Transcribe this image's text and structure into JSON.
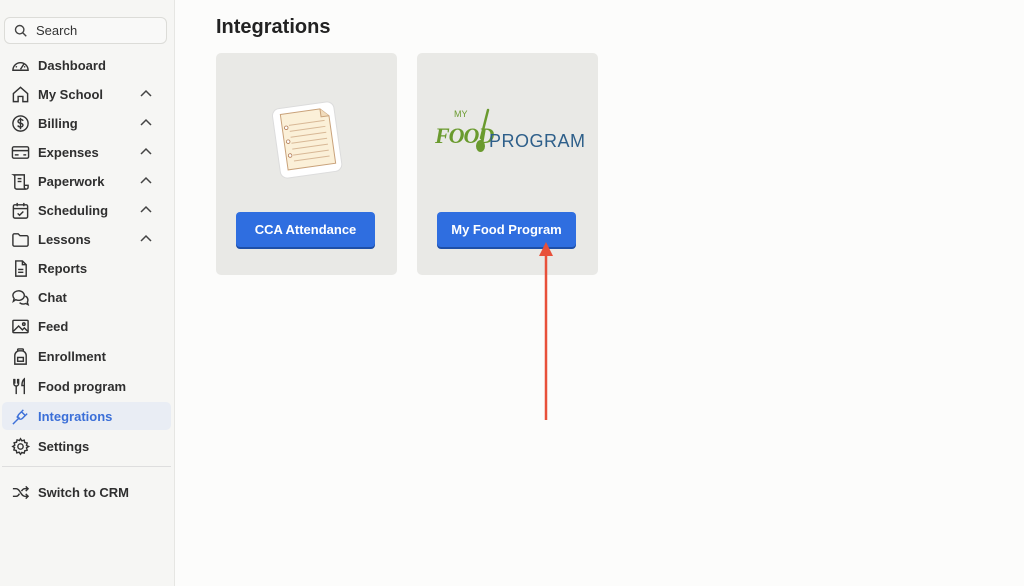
{
  "sidebar": {
    "search_placeholder": "Search",
    "items": [
      {
        "label": "Dashboard",
        "icon": "dashboard-gauge-icon"
      },
      {
        "label": "My School",
        "icon": "home-icon",
        "expandable": true
      },
      {
        "label": "Billing",
        "icon": "dollar-icon",
        "expandable": true
      },
      {
        "label": "Expenses",
        "icon": "credit-card-icon",
        "expandable": true
      },
      {
        "label": "Paperwork",
        "icon": "scroll-icon",
        "expandable": true
      },
      {
        "label": "Scheduling",
        "icon": "calendar-check-icon",
        "expandable": true
      },
      {
        "label": "Lessons",
        "icon": "folder-icon",
        "expandable": true
      },
      {
        "label": "Reports",
        "icon": "document-icon"
      },
      {
        "label": "Chat",
        "icon": "chat-icon"
      },
      {
        "label": "Feed",
        "icon": "image-icon"
      },
      {
        "label": "Enrollment",
        "icon": "backpack-icon"
      },
      {
        "label": "Food program",
        "icon": "fork-knife-icon"
      },
      {
        "label": "Integrations",
        "icon": "plug-icon",
        "active": true
      },
      {
        "label": "Settings",
        "icon": "gear-icon"
      }
    ],
    "switch_label": "Switch to CRM"
  },
  "main": {
    "title": "Integrations",
    "cards": [
      {
        "button": "CCA Attendance",
        "logo": "notepad-icon"
      },
      {
        "button": "My Food Program",
        "logo_top": "MY",
        "logo_food": "FOOD",
        "logo_program": "PROGRAM"
      }
    ]
  },
  "colors": {
    "accent": "#2f6ee0",
    "active_nav_text": "#3b6fd8",
    "annotation_arrow": "#e8503a",
    "logo_green": "#6a9a2e",
    "logo_blue": "#2e5f8a"
  }
}
